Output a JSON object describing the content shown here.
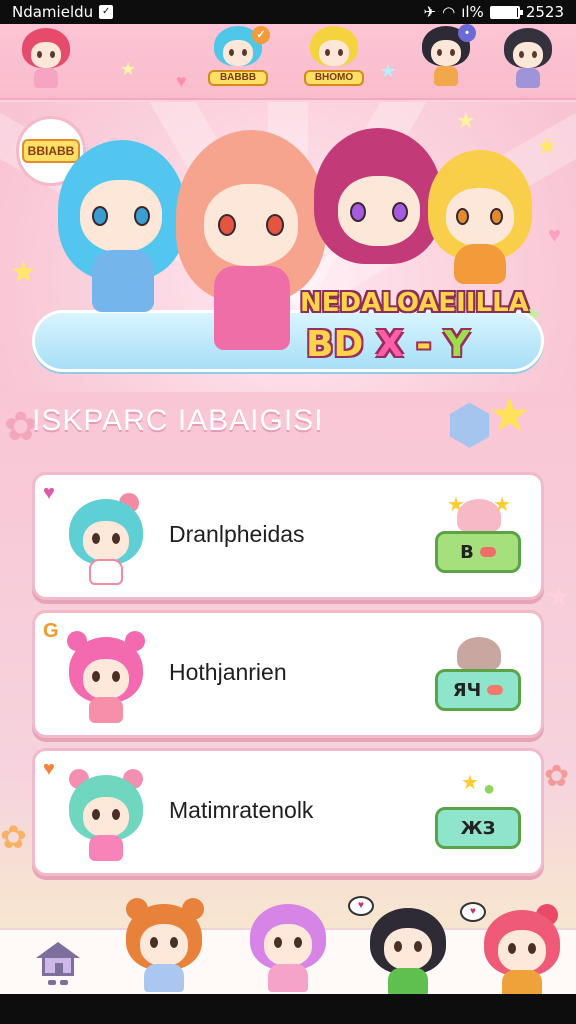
{
  "status_bar": {
    "carrier": "Ndamieldu",
    "box_glyph": "✓",
    "signal_text": "ıl%",
    "battery_level": 0.95,
    "time": "2523"
  },
  "top_strip": {
    "characters": [
      {
        "name_tag": ""
      },
      {
        "name_tag": "BABBB"
      },
      {
        "name_tag": "BHOMO"
      },
      {
        "name_tag": ""
      },
      {
        "name_tag": ""
      }
    ]
  },
  "hero": {
    "badge_text": "BBIABB",
    "title": "NEDALOAEIILLA",
    "subtitle_parts": [
      "BD",
      "X",
      "-",
      "Y"
    ]
  },
  "section": {
    "title": "ISKPARC IABAIGISI"
  },
  "cards": [
    {
      "label": "Dranlpheidas",
      "corner_icon": "heart-icon",
      "action_value": "B",
      "action_color": "#a5e07c",
      "dot_color": "#f26a6a"
    },
    {
      "label": "Hothjanrien",
      "corner_icon": "letter-badge-icon",
      "corner_text": "G",
      "action_value": "ЯЧ",
      "action_color": "#8fe4cc",
      "dot_color": "#f27a6a"
    },
    {
      "label": "Matimratenolk",
      "corner_icon": "heart-icon",
      "action_value": "ЖЗ",
      "action_color": "#8fe4cc",
      "dot_color": ""
    }
  ],
  "bottom_nav": {
    "home_icon": "home-icon"
  },
  "colors": {
    "background_pink": "#fbd3de",
    "card_border": "#f2b9ca",
    "title_yellow": "#ffd34a",
    "title_outline": "#8b2f59"
  }
}
